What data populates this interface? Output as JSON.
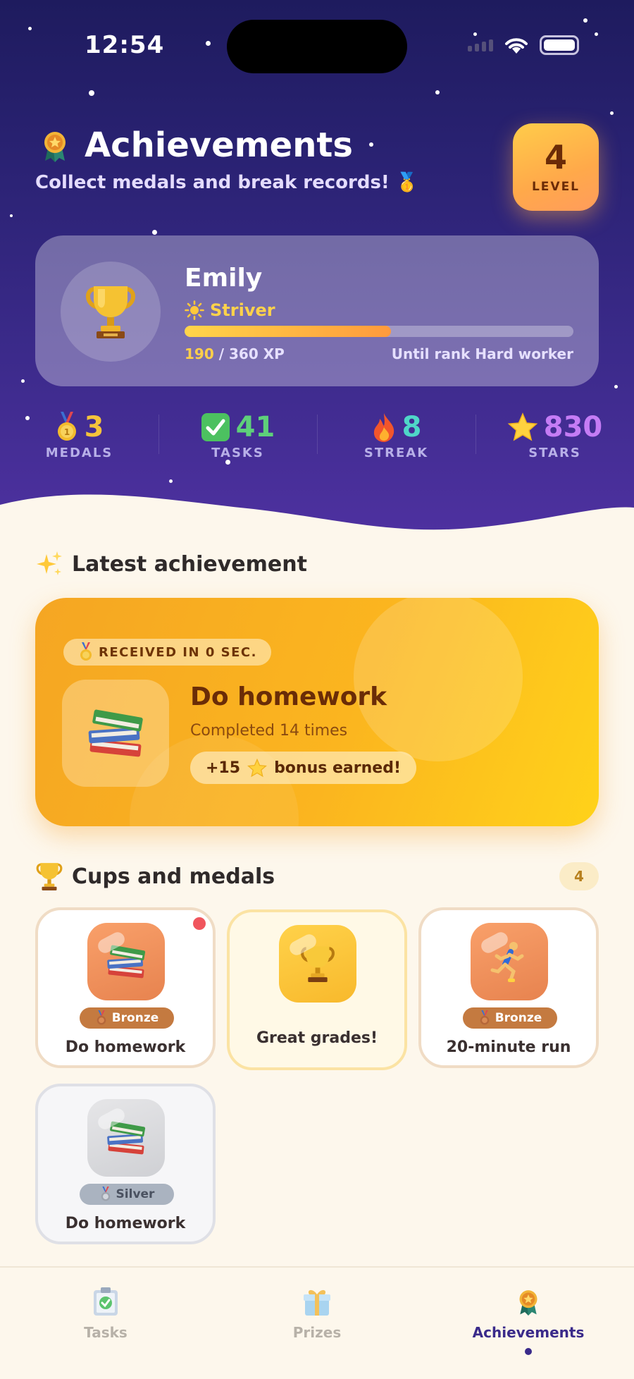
{
  "status_bar": {
    "time": "12:54"
  },
  "header": {
    "title": "Achievements",
    "subtitle": "Collect medals and break records! 🥇",
    "level": {
      "value": "4",
      "label": "LEVEL"
    }
  },
  "profile": {
    "name": "Emily",
    "rank": "Striver",
    "xp_current": "190",
    "xp_total": "/ 360 XP",
    "xp_progress": 0.53,
    "next_rank": "Until rank Hard worker"
  },
  "stats": [
    {
      "value": "3",
      "label": "MEDALS",
      "icon": "medal-icon",
      "color": "#f5c33b"
    },
    {
      "value": "41",
      "label": "TASKS",
      "icon": "check-icon",
      "color": "#5ed07a"
    },
    {
      "value": "8",
      "label": "STREAK",
      "icon": "fire-icon",
      "color": "#4fd6c8"
    },
    {
      "value": "830",
      "label": "STARS",
      "icon": "star-icon",
      "color": "#c57cf5"
    }
  ],
  "latest": {
    "section_title": "Latest achievement",
    "received": "RECEIVED IN 0 SEC.",
    "title": "Do homework",
    "subtitle": "Completed 14 times",
    "bonus_amount": "+15",
    "bonus_text": "bonus earned!"
  },
  "cups": {
    "section_title": "Cups and medals",
    "count": "4",
    "items": [
      {
        "name": "Do homework",
        "tier": "Bronze",
        "icon": "books-icon"
      },
      {
        "name": "Great grades!",
        "tier": "",
        "icon": "trophy-icon"
      },
      {
        "name": "20-minute run",
        "tier": "Bronze",
        "icon": "runner-icon"
      },
      {
        "name": "Do homework",
        "tier": "Silver",
        "icon": "books-icon"
      }
    ]
  },
  "tabs": [
    {
      "label": "Tasks",
      "icon": "clipboard-icon"
    },
    {
      "label": "Prizes",
      "icon": "gift-icon"
    },
    {
      "label": "Achievements",
      "icon": "award-icon",
      "active": true
    }
  ],
  "colors": {
    "hero_top": "#1e1b5e",
    "hero_bottom": "#4e31a0",
    "accent_orange": "#f5a623",
    "background": "#fdf7ec"
  }
}
